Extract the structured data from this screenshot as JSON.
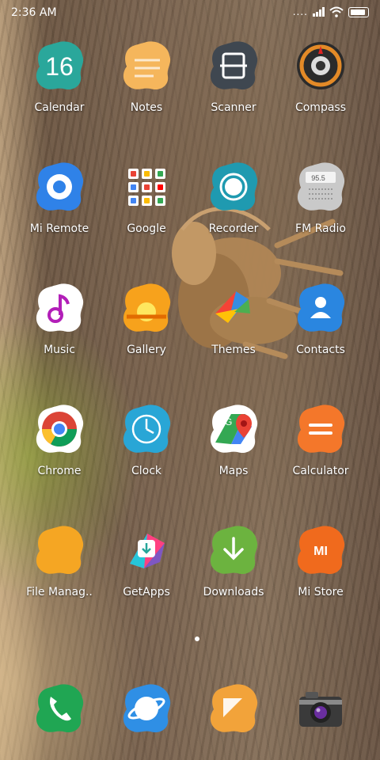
{
  "status_bar": {
    "time": "2:36 AM",
    "signal_dots": "....",
    "battery_level": 0.9
  },
  "apps": [
    {
      "label": "Calendar",
      "icon": "calendar-icon",
      "day": "16"
    },
    {
      "label": "Notes",
      "icon": "notes-icon"
    },
    {
      "label": "Scanner",
      "icon": "scanner-icon"
    },
    {
      "label": "Compass",
      "icon": "compass-icon"
    },
    {
      "label": "Mi Remote",
      "icon": "mi-remote-icon"
    },
    {
      "label": "Google",
      "icon": "google-folder-icon"
    },
    {
      "label": "Recorder",
      "icon": "recorder-icon"
    },
    {
      "label": "FM Radio",
      "icon": "fm-radio-icon",
      "freq": "95.5"
    },
    {
      "label": "Music",
      "icon": "music-icon"
    },
    {
      "label": "Gallery",
      "icon": "gallery-icon"
    },
    {
      "label": "Themes",
      "icon": "themes-icon"
    },
    {
      "label": "Contacts",
      "icon": "contacts-icon"
    },
    {
      "label": "Chrome",
      "icon": "chrome-icon"
    },
    {
      "label": "Clock",
      "icon": "clock-icon"
    },
    {
      "label": "Maps",
      "icon": "maps-icon"
    },
    {
      "label": "Calculator",
      "icon": "calculator-icon"
    },
    {
      "label": "File Manag..",
      "icon": "file-manager-icon"
    },
    {
      "label": "GetApps",
      "icon": "getapps-icon"
    },
    {
      "label": "Downloads",
      "icon": "downloads-icon"
    },
    {
      "label": "Mi Store",
      "icon": "mi-store-icon",
      "logo_text": "MI"
    }
  ],
  "dock": [
    {
      "icon": "phone-icon"
    },
    {
      "icon": "browser-icon"
    },
    {
      "icon": "security-icon"
    },
    {
      "icon": "camera-icon"
    }
  ],
  "colors": {
    "calendar": "#2aa79b",
    "notes": "#f5b65c",
    "scanner": "#3f4750",
    "compass": "#e38a27",
    "mi_remote": "#2f82e8",
    "recorder": "#1f9ab0",
    "fm_radio": "#c9c9c9",
    "music": "#ffffff",
    "gallery": "#f7a21c",
    "themes": "#ffffff",
    "contacts": "#2a86e0",
    "chrome": "#ffffff",
    "clock": "#29a6d6",
    "maps": "#ffffff",
    "calculator": "#f4772a",
    "file_manager": "#f5a623",
    "getapps": "#ffffff",
    "downloads": "#6cb33f",
    "mi_store": "#f06a1d",
    "phone": "#20a653",
    "browser": "#2f8fe5",
    "security": "#f2a33a"
  }
}
